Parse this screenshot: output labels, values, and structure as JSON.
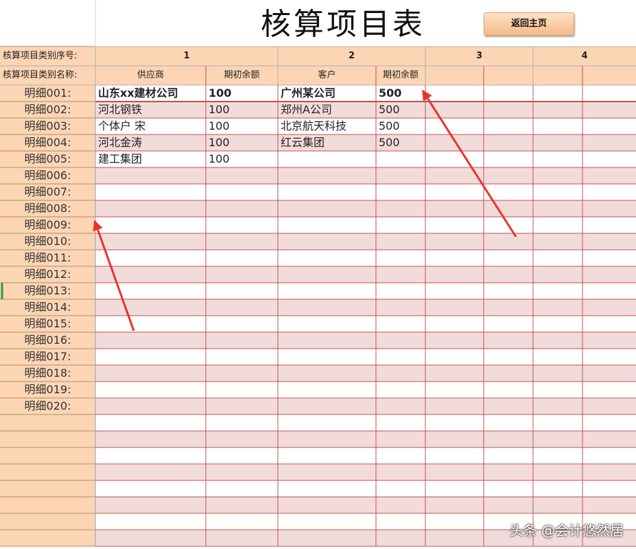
{
  "sheet": {
    "title": "核算项目表",
    "home_button": "返回主页",
    "seq_row_label": "核算项目类别序号:",
    "name_row_label": "核算项目类别名称:",
    "groups": [
      {
        "seq": "1",
        "name": "供应商",
        "col_balance": "期初余额"
      },
      {
        "seq": "2",
        "name": "客户",
        "col_balance": "期初余额"
      },
      {
        "seq": "3",
        "name": "",
        "col_balance": ""
      },
      {
        "seq": "4",
        "name": "",
        "col_balance": ""
      }
    ],
    "rows": [
      {
        "label": "明细001:",
        "c1": "山东xx建材公司",
        "c2": "100",
        "c3": "广州某公司",
        "c4": "500",
        "bold": true
      },
      {
        "label": "明细002:",
        "c1": "河北钢铁",
        "c2": "100",
        "c3": "郑州A公司",
        "c4": "500"
      },
      {
        "label": "明细003:",
        "c1": "个体户 宋",
        "c2": "100",
        "c3": "北京航天科技",
        "c4": "500"
      },
      {
        "label": "明细004:",
        "c1": "河北金涛",
        "c2": "100",
        "c3": "红云集团",
        "c4": "500"
      },
      {
        "label": "明细005:",
        "c1": "建工集团",
        "c2": "100",
        "c3": "",
        "c4": ""
      },
      {
        "label": "明细006:"
      },
      {
        "label": "明细007:"
      },
      {
        "label": "明细008:"
      },
      {
        "label": "明细009:"
      },
      {
        "label": "明细010:"
      },
      {
        "label": "明细011:"
      },
      {
        "label": "明细012:"
      },
      {
        "label": "明细013:"
      },
      {
        "label": "明细014:"
      },
      {
        "label": "明细015:"
      },
      {
        "label": "明细016:"
      },
      {
        "label": "明细017:"
      },
      {
        "label": "明细018:"
      },
      {
        "label": "明细019:"
      },
      {
        "label": "明细020:"
      },
      {
        "label": ""
      },
      {
        "label": ""
      },
      {
        "label": ""
      },
      {
        "label": ""
      },
      {
        "label": ""
      },
      {
        "label": ""
      },
      {
        "label": ""
      },
      {
        "label": ""
      }
    ]
  },
  "colors": {
    "header_fill": "#fcd5b5",
    "band_fill": "#f2dcdb",
    "grid": "#c0504d",
    "arrow": "#e8322b"
  },
  "watermark": "头条 @会计悠然居"
}
